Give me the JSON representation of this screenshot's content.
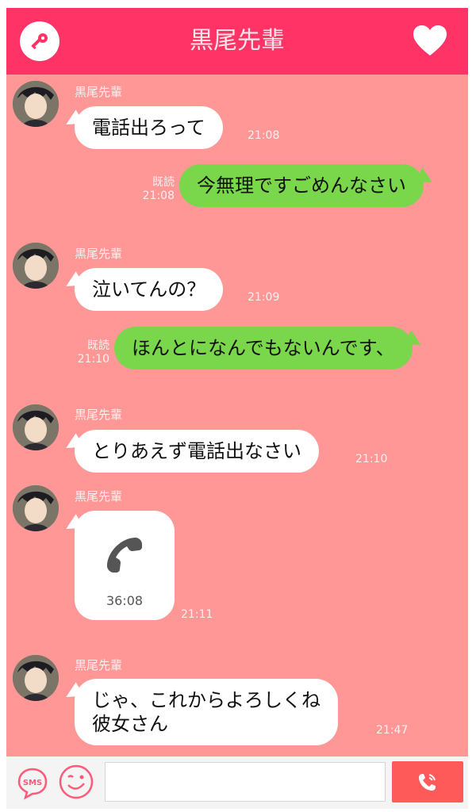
{
  "header": {
    "title": "黒尾先輩"
  },
  "colors": {
    "header_bg": "#ff3366",
    "chat_bg": "#ff9797",
    "incoming_bubble": "#ffffff",
    "outgoing_bubble": "#7ad64a",
    "call_button": "#ff5a5a"
  },
  "messages": [
    {
      "direction": "in",
      "sender": "黒尾先輩",
      "text": "電話出ろって",
      "time": "21:08"
    },
    {
      "direction": "out",
      "read": "既読",
      "text": "今無理ですごめんなさい",
      "time": "21:08"
    },
    {
      "direction": "in",
      "sender": "黒尾先輩",
      "text": "泣いてんの？",
      "time": "21:09"
    },
    {
      "direction": "out",
      "read": "既読",
      "text": "ほんとになんでもないんです、",
      "time": "21:10"
    },
    {
      "direction": "in",
      "sender": "黒尾先輩",
      "text": "とりあえず電話出なさい",
      "time": "21:10"
    },
    {
      "direction": "in",
      "sender": "黒尾先輩",
      "type": "call",
      "call_duration": "36:08",
      "time": "21:11"
    },
    {
      "direction": "in",
      "sender": "黒尾先輩",
      "text_line1": "じゃ、これからよろしくね",
      "text_line2": "彼女さん",
      "time": "21:47"
    }
  ],
  "bottom_bar": {
    "sms_label": "SMS",
    "input_value": "",
    "icons": [
      "sms-icon",
      "smile-icon",
      "phone-icon"
    ]
  },
  "header_icons": [
    "key-icon",
    "heart-icon"
  ]
}
